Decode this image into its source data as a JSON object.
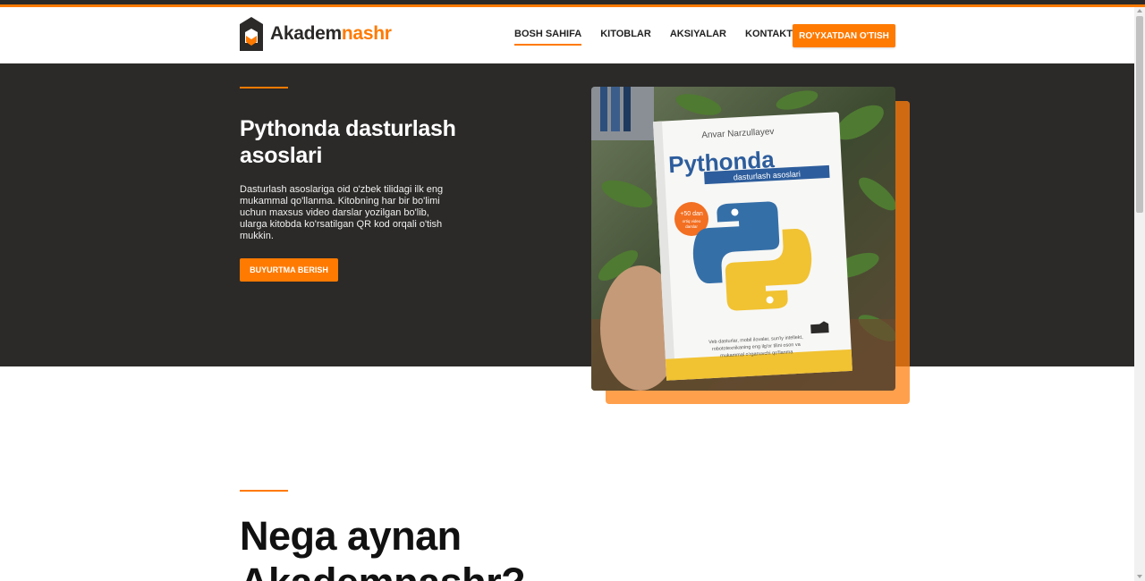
{
  "brand": {
    "name_part1": "Akadem",
    "name_part2": "nashr",
    "accent_color": "#ff7a00",
    "dark_color": "#2b2a28"
  },
  "nav": {
    "items": [
      {
        "label": "BOSH SAHIFA",
        "active": true
      },
      {
        "label": "KITOBLAR",
        "active": false
      },
      {
        "label": "AKSIYALAR",
        "active": false
      },
      {
        "label": "KONTAKTLAR",
        "active": false
      }
    ],
    "register_label": "RO'YXATDAN O'TISH"
  },
  "hero": {
    "title": "Pythonda dasturlash asoslari",
    "description": "Dasturlash asoslariga oid o'zbek tilidagi ilk eng mukammal qo'llanma. Kitobning har bir bo'limi uchun maxsus video darslar yozilgan bo'lib, ularga kitobda ko'rsatilgan QR kod orqali o'tish mukkin.",
    "order_label": "BUYURTMA BERISH"
  },
  "book": {
    "author": "Anvar Narzullayev",
    "title": "Pythonda",
    "subtitle": "dasturlash asoslari",
    "badge_line1": "+50 dan",
    "badge_line2": "ortiq video",
    "badge_line3": "darslar",
    "blurb_line1": "Veb dasturlar, mobil ilovalar, sun'iy intellekt,",
    "blurb_line2": "robototexnikaning eng ilg'or tilini oson va",
    "blurb_line3": "mukammal o'rganuvchi qo'llanma"
  },
  "section": {
    "title": "Nega aynan Akademnashr?"
  },
  "icons": {
    "logo": "logo-mark-icon"
  }
}
